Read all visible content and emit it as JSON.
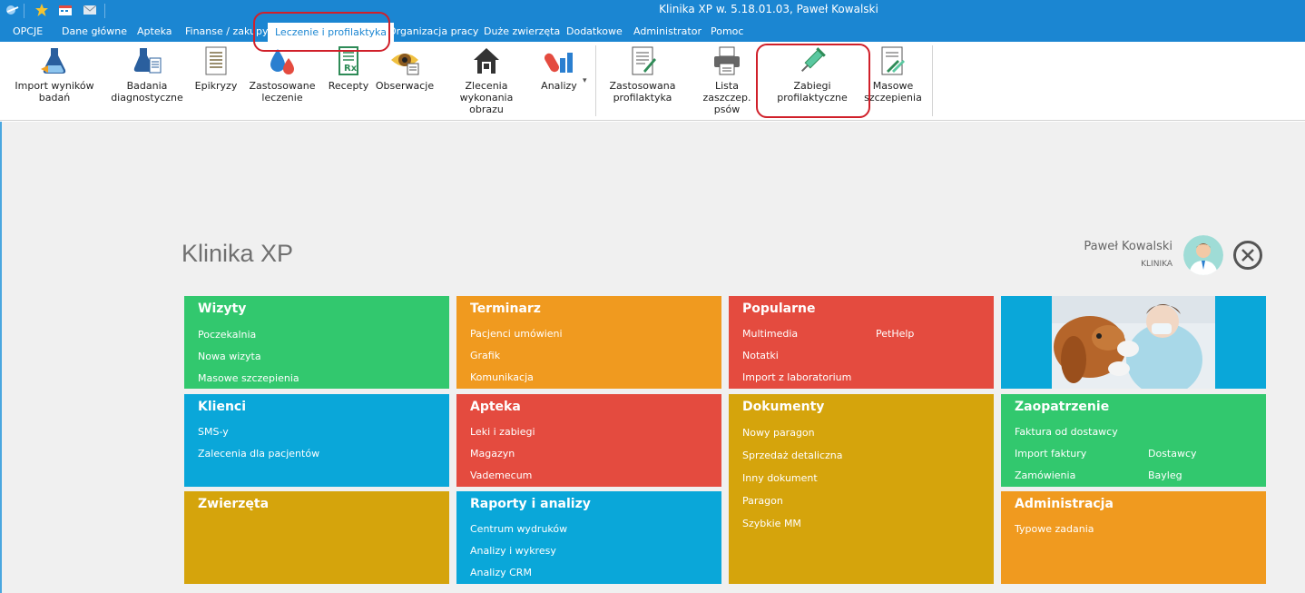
{
  "window": {
    "title": "Klinika XP w. 5.18.01.03, Paweł Kowalski"
  },
  "menu": {
    "items": [
      "OPCJE",
      "Dane główne",
      "Apteka",
      "Finanse / zakupy",
      "Leczenie i profilaktyka",
      "Organizacja pracy",
      "Duże zwierzęta",
      "Dodatkowe",
      "Administrator",
      "Pomoc"
    ],
    "active": "Leczenie i profilaktyka"
  },
  "ribbon": {
    "buttons": [
      {
        "label1": "Import wyników",
        "label2": "badań",
        "icon": "flask-import-icon"
      },
      {
        "label1": "Badania",
        "label2": "diagnostyczne",
        "icon": "flask-doc-icon"
      },
      {
        "label1": "Epikryzy",
        "label2": "",
        "icon": "document-list-icon"
      },
      {
        "label1": "Zastosowane",
        "label2": "leczenie",
        "icon": "drops-icon"
      },
      {
        "label1": "Recepty",
        "label2": "",
        "icon": "prescription-icon"
      },
      {
        "label1": "Obserwacje",
        "label2": "",
        "icon": "eye-icon"
      },
      {
        "label1": "Zlecenia wykonania",
        "label2": "obrazu",
        "icon": "house-icon"
      },
      {
        "label1": "Analizy",
        "label2": "",
        "icon": "pills-icon"
      },
      {
        "label1": "Zastosowana",
        "label2": "profilaktyka",
        "icon": "doc-pen-icon"
      },
      {
        "label1": "Lista zaszczep.",
        "label2": "psów",
        "icon": "printer-icon"
      },
      {
        "label1": "Zabiegi",
        "label2": "profilaktyczne",
        "icon": "syringe-icon"
      },
      {
        "label1": "Masowe",
        "label2": "szczepienia",
        "icon": "multi-syringe-icon"
      }
    ]
  },
  "main": {
    "app_title": "Klinika XP",
    "user": {
      "name": "Paweł Kowalski",
      "org": "KLINIKA"
    },
    "tiles": [
      {
        "title": "Wizyty",
        "links": [
          "Poczekalnia",
          "Nowa wizyta",
          "Masowe szczepienia"
        ]
      },
      {
        "title": "Terminarz",
        "links": [
          "Pacjenci umówieni",
          "Grafik",
          "Komunikacja"
        ]
      },
      {
        "title": "Popularne",
        "links": [
          "Multimedia",
          "Notatki",
          "Import z laboratorium",
          "PetHelp"
        ]
      },
      {
        "title": "Klienci",
        "links": [
          "SMS-y",
          "Zalecenia dla pacjentów"
        ]
      },
      {
        "title": "Apteka",
        "links": [
          "Leki i zabiegi",
          "Magazyn",
          "Vademecum"
        ]
      },
      {
        "title": "Dokumenty",
        "links": [
          "Nowy paragon",
          "Sprzedaż detaliczna",
          "Inny dokument",
          "Paragon",
          "Szybkie MM"
        ]
      },
      {
        "title": "Zaopatrzenie",
        "links": [
          "Faktura od dostawcy",
          "Import faktury",
          "Zamówienia",
          "Dostawcy",
          "Bayleg"
        ]
      },
      {
        "title": "Zwierzęta",
        "links": []
      },
      {
        "title": "Raporty i analizy",
        "links": [
          "Centrum wydruków",
          "Analizy i wykresy",
          "Analizy CRM"
        ]
      },
      {
        "title": "Administracja",
        "links": [
          "Typowe zadania"
        ]
      }
    ]
  },
  "colors": {
    "titlebar": "#1b86d2",
    "green": "#32c86e",
    "orange": "#f09a1f",
    "red": "#e44b3f",
    "blue": "#0aa7d9",
    "olive": "#d5a40c",
    "highlight": "#d0202a"
  }
}
